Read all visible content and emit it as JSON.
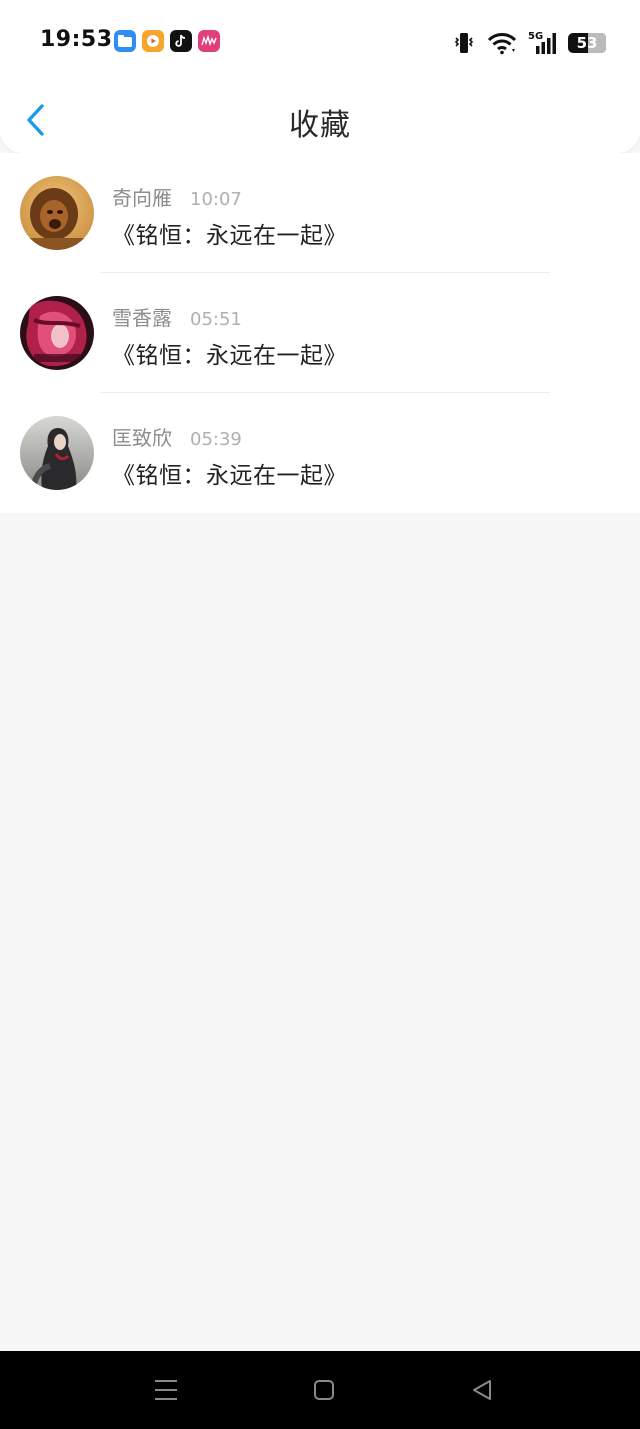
{
  "status_bar": {
    "time": "19:53",
    "apps": [
      "files-app-icon",
      "video-app-icon",
      "tiktok-app-icon",
      "music-app-icon"
    ],
    "network": "5G",
    "battery": 53,
    "icons": [
      "vibrate-icon",
      "wifi-icon",
      "cellular-signal-icon",
      "battery-icon"
    ]
  },
  "header": {
    "title": "收藏",
    "back_icon": "chevron-left-icon",
    "accent_color": "#1e9be8"
  },
  "favorites": [
    {
      "name": "奇向雁",
      "time": "10:07",
      "title": "《铭恒：永远在一起》",
      "avatar": "lion-avatar"
    },
    {
      "name": "雪香露",
      "time": "05:51",
      "title": "《铭恒：永远在一起》",
      "avatar": "red-hair-girl-avatar"
    },
    {
      "name": "匡致欣",
      "time": "05:39",
      "title": "《铭恒：永远在一起》",
      "avatar": "sitting-woman-avatar"
    }
  ],
  "nav_bar": {
    "icons": [
      "menu-icon",
      "home-icon",
      "back-triangle-icon"
    ]
  }
}
